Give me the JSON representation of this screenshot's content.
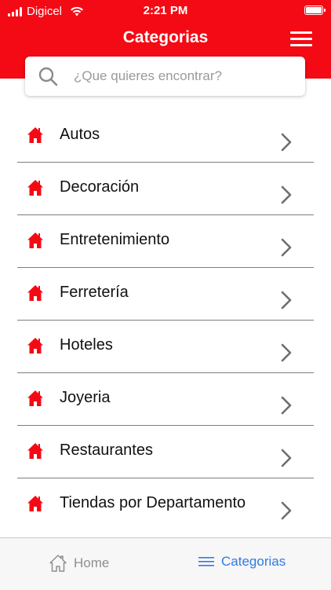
{
  "status_bar": {
    "carrier": "Digicel",
    "time": "2:21 PM"
  },
  "header": {
    "title": "Categorias"
  },
  "search": {
    "placeholder": "¿Que quieres encontrar?"
  },
  "categories": [
    {
      "label": "Autos"
    },
    {
      "label": "Decoración"
    },
    {
      "label": "Entretenimiento"
    },
    {
      "label": "Ferretería"
    },
    {
      "label": "Hoteles"
    },
    {
      "label": "Joyeria"
    },
    {
      "label": "Restaurantes"
    },
    {
      "label": "Tiendas por Departamento"
    }
  ],
  "tabbar": {
    "home_label": "Home",
    "categories_label": "Categorias",
    "active_tab": "Categorias"
  },
  "colors": {
    "brand_red": "#f40a14",
    "active_blue": "#2f7be3",
    "inactive_gray": "#8e8e93"
  },
  "icons": {
    "row_icon": "house-icon",
    "row_chevron": "chevron-right-icon",
    "search": "search-icon",
    "menu": "hamburger-menu-icon"
  }
}
